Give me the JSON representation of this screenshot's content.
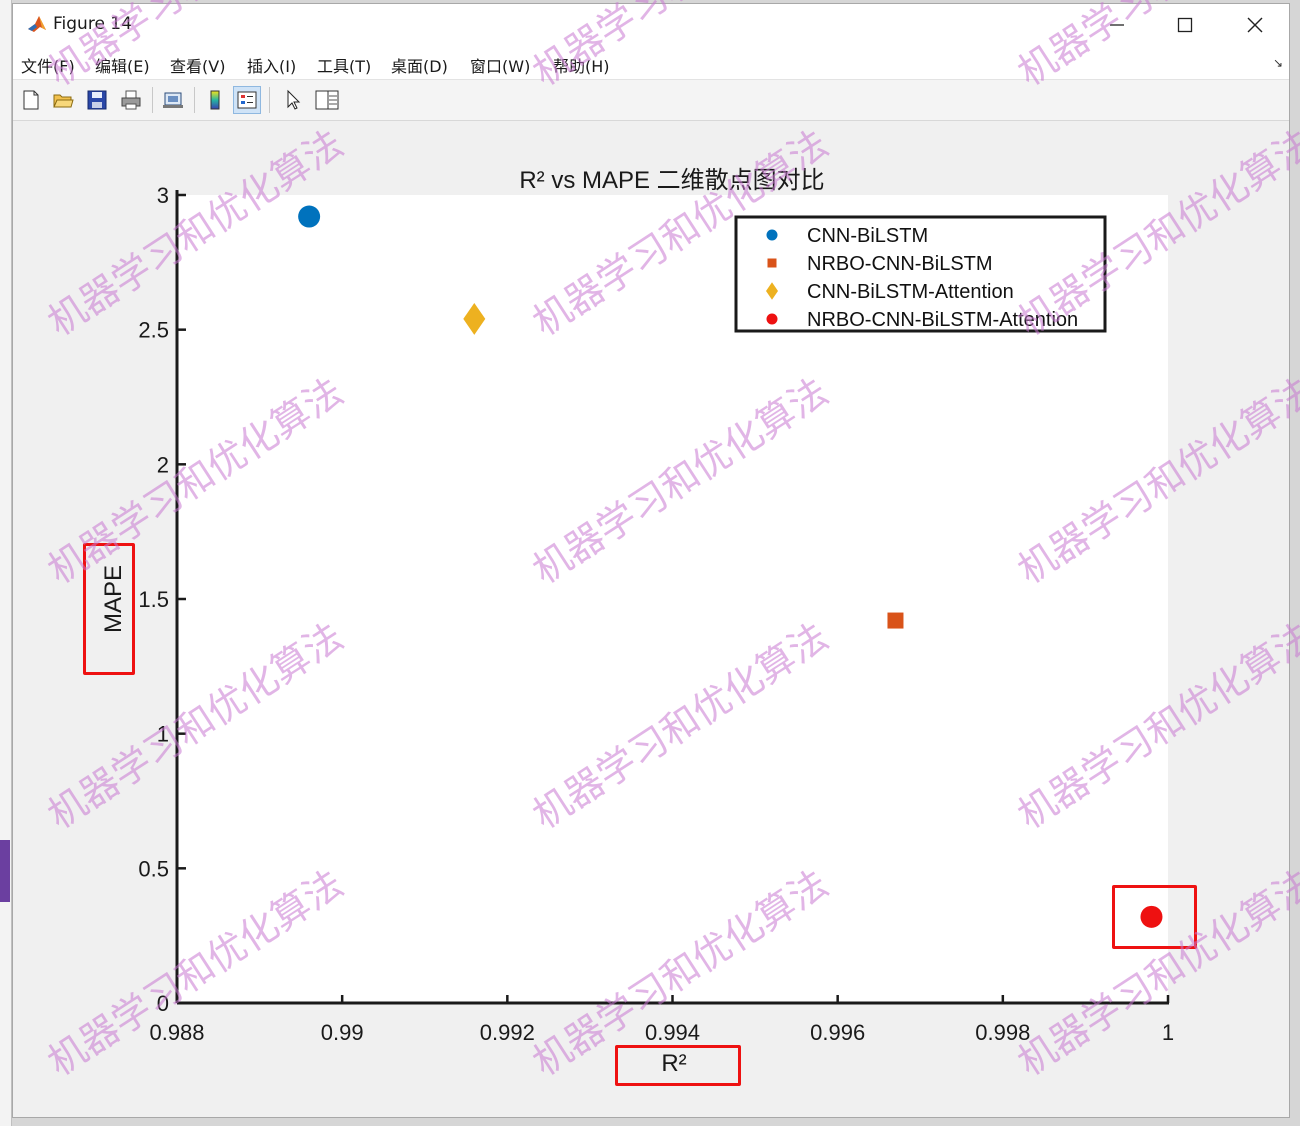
{
  "window": {
    "title": "Figure 14",
    "minimize_icon": "minimize-icon",
    "maximize_icon": "maximize-icon",
    "close_icon": "close-icon"
  },
  "menu": {
    "items": [
      "文件(F)",
      "编辑(E)",
      "查看(V)",
      "插入(I)",
      "工具(T)",
      "桌面(D)",
      "窗口(W)",
      "帮助(H)"
    ],
    "corner": "↘"
  },
  "toolbar": {
    "icons": [
      "new-figure-icon",
      "open-file-icon",
      "save-icon",
      "print-icon",
      "link-plot-icon",
      "colorbar-icon",
      "legend-icon",
      "pointer-icon",
      "property-editor-icon"
    ]
  },
  "watermark": "机器学习和优化算法",
  "chart_data": {
    "type": "scatter",
    "title": "R² vs MAPE 二维散点图对比",
    "xlabel": "R²",
    "ylabel": "MAPE",
    "xlim": [
      0.988,
      1.0
    ],
    "ylim": [
      0,
      3
    ],
    "x_ticks": [
      "0.988",
      "0.99",
      "0.992",
      "0.994",
      "0.996",
      "0.998",
      "1"
    ],
    "y_ticks": [
      "0",
      "0.5",
      "1",
      "1.5",
      "2",
      "2.5",
      "3"
    ],
    "legend_position": "top-right",
    "series": [
      {
        "name": "CNN-BiLSTM",
        "marker": "circle",
        "color": "#0072BD",
        "x": 0.9896,
        "y": 2.92
      },
      {
        "name": "NRBO-CNN-BiLSTM",
        "marker": "square",
        "color": "#D95319",
        "x": 0.9967,
        "y": 1.42
      },
      {
        "name": "CNN-BiLSTM-Attention",
        "marker": "diamond",
        "color": "#EDB120",
        "x": 0.9916,
        "y": 2.54
      },
      {
        "name": "NRBO-CNN-BiLSTM-Attention",
        "marker": "circle",
        "color": "#EE1111",
        "x": 0.9998,
        "y": 0.32
      }
    ]
  }
}
